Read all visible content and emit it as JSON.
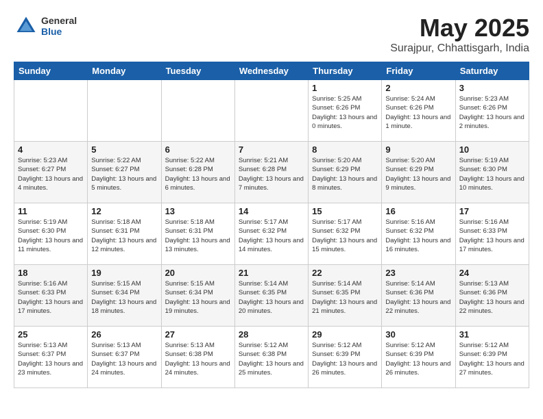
{
  "header": {
    "logo_general": "General",
    "logo_blue": "Blue",
    "month_title": "May 2025",
    "subtitle": "Surajpur, Chhattisgarh, India"
  },
  "weekdays": [
    "Sunday",
    "Monday",
    "Tuesday",
    "Wednesday",
    "Thursday",
    "Friday",
    "Saturday"
  ],
  "weeks": [
    [
      {
        "day": "",
        "info": ""
      },
      {
        "day": "",
        "info": ""
      },
      {
        "day": "",
        "info": ""
      },
      {
        "day": "",
        "info": ""
      },
      {
        "day": "1",
        "info": "Sunrise: 5:25 AM\nSunset: 6:26 PM\nDaylight: 13 hours and 0 minutes."
      },
      {
        "day": "2",
        "info": "Sunrise: 5:24 AM\nSunset: 6:26 PM\nDaylight: 13 hours and 1 minute."
      },
      {
        "day": "3",
        "info": "Sunrise: 5:23 AM\nSunset: 6:26 PM\nDaylight: 13 hours and 2 minutes."
      }
    ],
    [
      {
        "day": "4",
        "info": "Sunrise: 5:23 AM\nSunset: 6:27 PM\nDaylight: 13 hours and 4 minutes."
      },
      {
        "day": "5",
        "info": "Sunrise: 5:22 AM\nSunset: 6:27 PM\nDaylight: 13 hours and 5 minutes."
      },
      {
        "day": "6",
        "info": "Sunrise: 5:22 AM\nSunset: 6:28 PM\nDaylight: 13 hours and 6 minutes."
      },
      {
        "day": "7",
        "info": "Sunrise: 5:21 AM\nSunset: 6:28 PM\nDaylight: 13 hours and 7 minutes."
      },
      {
        "day": "8",
        "info": "Sunrise: 5:20 AM\nSunset: 6:29 PM\nDaylight: 13 hours and 8 minutes."
      },
      {
        "day": "9",
        "info": "Sunrise: 5:20 AM\nSunset: 6:29 PM\nDaylight: 13 hours and 9 minutes."
      },
      {
        "day": "10",
        "info": "Sunrise: 5:19 AM\nSunset: 6:30 PM\nDaylight: 13 hours and 10 minutes."
      }
    ],
    [
      {
        "day": "11",
        "info": "Sunrise: 5:19 AM\nSunset: 6:30 PM\nDaylight: 13 hours and 11 minutes."
      },
      {
        "day": "12",
        "info": "Sunrise: 5:18 AM\nSunset: 6:31 PM\nDaylight: 13 hours and 12 minutes."
      },
      {
        "day": "13",
        "info": "Sunrise: 5:18 AM\nSunset: 6:31 PM\nDaylight: 13 hours and 13 minutes."
      },
      {
        "day": "14",
        "info": "Sunrise: 5:17 AM\nSunset: 6:32 PM\nDaylight: 13 hours and 14 minutes."
      },
      {
        "day": "15",
        "info": "Sunrise: 5:17 AM\nSunset: 6:32 PM\nDaylight: 13 hours and 15 minutes."
      },
      {
        "day": "16",
        "info": "Sunrise: 5:16 AM\nSunset: 6:32 PM\nDaylight: 13 hours and 16 minutes."
      },
      {
        "day": "17",
        "info": "Sunrise: 5:16 AM\nSunset: 6:33 PM\nDaylight: 13 hours and 17 minutes."
      }
    ],
    [
      {
        "day": "18",
        "info": "Sunrise: 5:16 AM\nSunset: 6:33 PM\nDaylight: 13 hours and 17 minutes."
      },
      {
        "day": "19",
        "info": "Sunrise: 5:15 AM\nSunset: 6:34 PM\nDaylight: 13 hours and 18 minutes."
      },
      {
        "day": "20",
        "info": "Sunrise: 5:15 AM\nSunset: 6:34 PM\nDaylight: 13 hours and 19 minutes."
      },
      {
        "day": "21",
        "info": "Sunrise: 5:14 AM\nSunset: 6:35 PM\nDaylight: 13 hours and 20 minutes."
      },
      {
        "day": "22",
        "info": "Sunrise: 5:14 AM\nSunset: 6:35 PM\nDaylight: 13 hours and 21 minutes."
      },
      {
        "day": "23",
        "info": "Sunrise: 5:14 AM\nSunset: 6:36 PM\nDaylight: 13 hours and 22 minutes."
      },
      {
        "day": "24",
        "info": "Sunrise: 5:13 AM\nSunset: 6:36 PM\nDaylight: 13 hours and 22 minutes."
      }
    ],
    [
      {
        "day": "25",
        "info": "Sunrise: 5:13 AM\nSunset: 6:37 PM\nDaylight: 13 hours and 23 minutes."
      },
      {
        "day": "26",
        "info": "Sunrise: 5:13 AM\nSunset: 6:37 PM\nDaylight: 13 hours and 24 minutes."
      },
      {
        "day": "27",
        "info": "Sunrise: 5:13 AM\nSunset: 6:38 PM\nDaylight: 13 hours and 24 minutes."
      },
      {
        "day": "28",
        "info": "Sunrise: 5:12 AM\nSunset: 6:38 PM\nDaylight: 13 hours and 25 minutes."
      },
      {
        "day": "29",
        "info": "Sunrise: 5:12 AM\nSunset: 6:39 PM\nDaylight: 13 hours and 26 minutes."
      },
      {
        "day": "30",
        "info": "Sunrise: 5:12 AM\nSunset: 6:39 PM\nDaylight: 13 hours and 26 minutes."
      },
      {
        "day": "31",
        "info": "Sunrise: 5:12 AM\nSunset: 6:39 PM\nDaylight: 13 hours and 27 minutes."
      }
    ]
  ]
}
